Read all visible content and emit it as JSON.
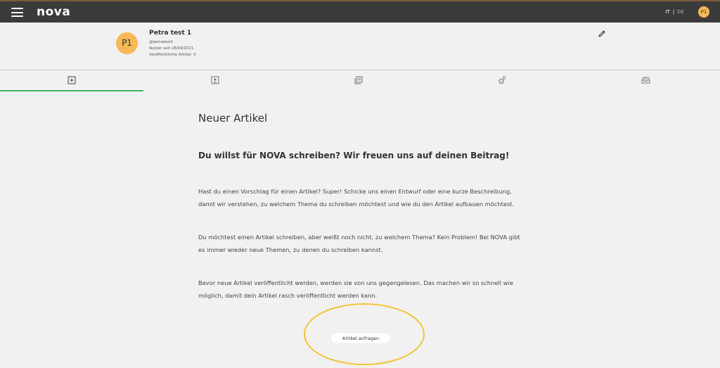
{
  "header": {
    "logo": "nova",
    "lang_it": "IT",
    "lang_sep": "|",
    "lang_de": "DE",
    "avatar_initials": "P1"
  },
  "profile": {
    "initials": "P1",
    "name": "Petra test 1",
    "handle": "@petratest1",
    "member_since": "Nutzer seit 28/04/2021",
    "published_articles": "Veröffentlichte Artikel: 0"
  },
  "tabs": [
    {
      "icon": "plus-square-icon",
      "active": true
    },
    {
      "icon": "profile-card-icon",
      "active": false
    },
    {
      "icon": "articles-stack-icon",
      "active": false
    },
    {
      "icon": "badge-medal-icon",
      "active": false
    },
    {
      "icon": "inbox-icon",
      "active": false
    }
  ],
  "main": {
    "title": "Neuer Artikel",
    "subtitle": "Du willst für NOVA schreiben? Wir freuen uns auf deinen Beitrag!",
    "paragraph1_line1": "Hast du einen Vorschlag für einen Artikel? Super! Schicke uns einen Entwurf oder eine kurze Beschreibung,",
    "paragraph1_line2": "damit wir verstehen, zu welchem Thema du schreiben möchtest und wie du den Artikel aufbauen möchtest.",
    "paragraph2_line1": "Du möchtest einen Artikel schreiben, aber weißt noch nicht, zu welchem Thema? Kein Problem! Bei NOVA gibt",
    "paragraph2_line2": "es immer wieder neue Themen, zu denen du schreiben kannst.",
    "paragraph3_line1": "Bevor neue Artikel veröffentlicht werden, werden sie von uns gegengelesen. Das machen wir so schnell wie",
    "paragraph3_line2": "möglich, damit dein Artikel rasch veröffentlicht werden kann.",
    "request_button": "Artikel anfragen"
  },
  "colors": {
    "topbar": "#3c3b3b",
    "avatar": "#f7b955",
    "active_tab": "#3ab26b",
    "highlight": "#f4c430",
    "background": "#f1f1f1"
  }
}
